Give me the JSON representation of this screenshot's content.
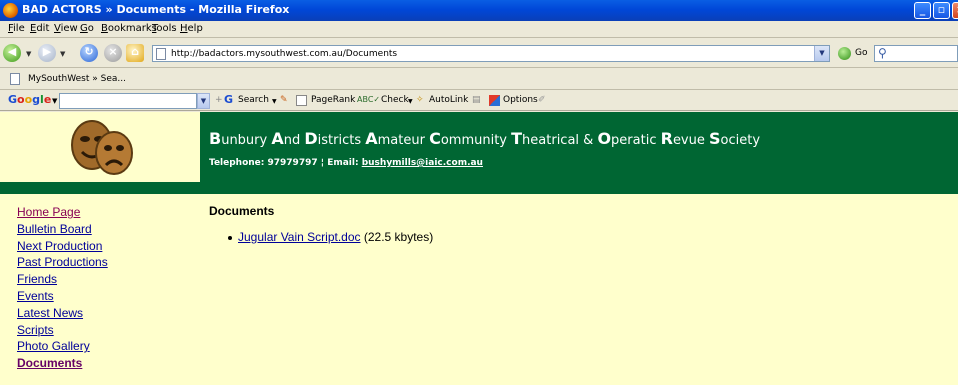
{
  "window": {
    "title": "BAD ACTORS » Documents - Mozilla Firefox"
  },
  "menubar": {
    "items": [
      "File",
      "Edit",
      "View",
      "Go",
      "Bookmarks",
      "Tools",
      "Help"
    ]
  },
  "navbar": {
    "url": "http://badactors.mysouthwest.com.au/Documents",
    "go_label": "Go"
  },
  "bookmarks": {
    "items": [
      "MySouthWest » Sea..."
    ]
  },
  "google_toolbar": {
    "logo": "Google",
    "search_label": "Search",
    "pagerank_label": "PageRank",
    "check_label": "Check",
    "autolink_label": "AutoLink",
    "options_label": "Options"
  },
  "site": {
    "title_parts": [
      {
        "initial": "B",
        "rest": "unbury "
      },
      {
        "initial": "A",
        "rest": "nd "
      },
      {
        "initial": "D",
        "rest": "istricts "
      },
      {
        "initial": "A",
        "rest": "mateur "
      },
      {
        "initial": "C",
        "rest": "ommunity "
      },
      {
        "initial": "T",
        "rest": "heatrical & "
      },
      {
        "initial": "O",
        "rest": "peratic "
      },
      {
        "initial": "R",
        "rest": "evue "
      },
      {
        "initial": "S",
        "rest": "ociety"
      }
    ],
    "telephone_label": "Telephone: 97979797",
    "separator": " ¦ ",
    "email_label": "Email: ",
    "email": "bushymills@iaic.com.au"
  },
  "nav": {
    "items": [
      {
        "label": "Home Page",
        "state": "visited"
      },
      {
        "label": "Bulletin Board",
        "state": "link"
      },
      {
        "label": "Next Production",
        "state": "link"
      },
      {
        "label": "Past Productions",
        "state": "link"
      },
      {
        "label": "Friends",
        "state": "link"
      },
      {
        "label": "Events",
        "state": "link"
      },
      {
        "label": "Latest News",
        "state": "link"
      },
      {
        "label": "Scripts",
        "state": "link"
      },
      {
        "label": "Photo Gallery",
        "state": "link"
      },
      {
        "label": "Documents",
        "state": "current"
      }
    ]
  },
  "content": {
    "heading": "Documents",
    "documents": [
      {
        "name": "Jugular Vain Script.doc",
        "size": "(22.5 kbytes)"
      }
    ]
  },
  "colors": {
    "header_bg": "#006633",
    "page_bg": "#ffffcc",
    "link": "#000099"
  }
}
